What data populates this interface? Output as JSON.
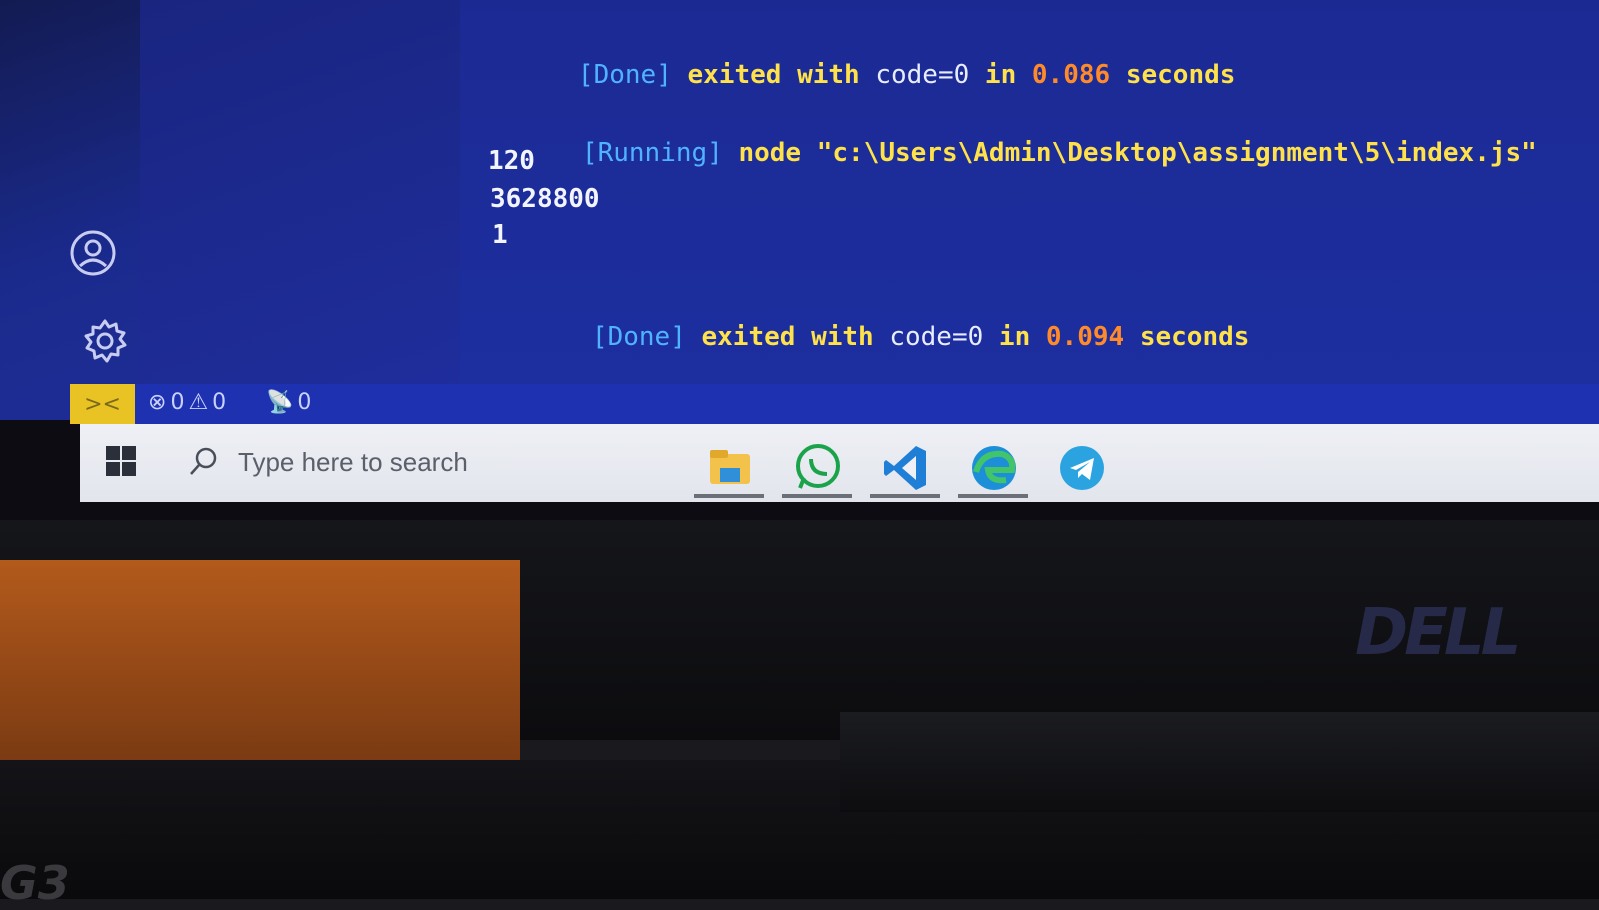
{
  "output": {
    "line1": {
      "tag": "[Done]",
      "exited": "exited with",
      "code": "code=0",
      "in": "in",
      "time": "0.086",
      "seconds": "seconds"
    },
    "line2": {
      "tag": "[Running]",
      "cmd": "node",
      "path": "\"c:\\Users\\Admin\\Desktop\\assignment\\5\\index.js\""
    },
    "results": [
      "120",
      "3628800",
      "1"
    ],
    "line3": {
      "tag": "[Done]",
      "exited": "exited with",
      "code": "code=0",
      "in": "in",
      "time": "0.094",
      "seconds": "seconds"
    }
  },
  "status_bar": {
    "errors": "0",
    "warnings": "0",
    "ports": "0"
  },
  "taskbar": {
    "search_placeholder": "Type here to search",
    "apps": [
      "file-explorer",
      "whatsapp",
      "vscode",
      "edge",
      "telegram"
    ]
  },
  "brand": {
    "monitor": "DELL",
    "keyboard": "G3"
  },
  "colors": {
    "editor_bg": "#1d2ea0",
    "status_remote": "#e9c224",
    "keyword": "#ffe24a",
    "number": "#ff8a2a",
    "bracket": "#4fb3ff"
  }
}
